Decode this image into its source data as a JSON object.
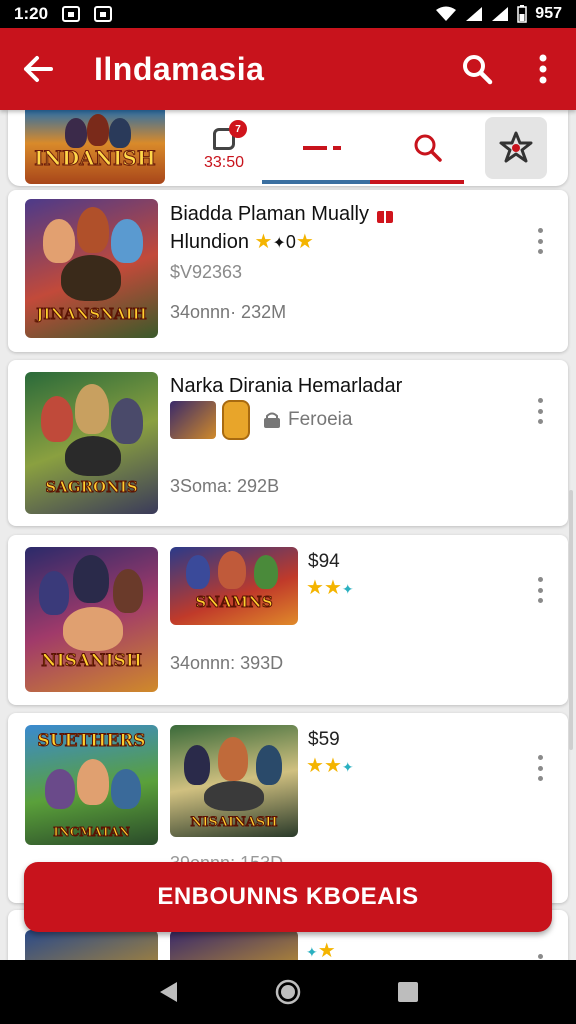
{
  "status": {
    "time": "1:20",
    "battery": "957"
  },
  "app_bar": {
    "title": "Ilndamasia",
    "back_icon": "arrow-left-icon",
    "search_icon": "search-icon",
    "menu_icon": "more-vert-icon"
  },
  "tabs": {
    "banner_logo": "INDANISH",
    "notif_badge": "7",
    "notif_count": "33:50"
  },
  "cards": [
    {
      "thumb_logo": "JINANSNAIH",
      "name_line1": "Biadda Plaman Mually",
      "name_line2": "Hlundion",
      "name_extra": "0",
      "price": "$V92363",
      "meta": "34onnn· 232M"
    },
    {
      "thumb_logo": "SAGRONIS",
      "name_line1": "Narka Dirania Hemarladar",
      "tag": "Feroeia",
      "meta": "3Soma: 292B"
    },
    {
      "thumb_logo": "NISANISH",
      "thumb2_logo": "SNAMNS",
      "price": "$94",
      "meta": "34onnn: 393D"
    },
    {
      "thumb_logo": "SUETHERS",
      "thumb_logo_sub": "INCMATAN",
      "thumb2_logo": "NISAINASH",
      "price": "$59",
      "meta": "39onnn: 153D"
    }
  ],
  "action_button": {
    "label": "ENBOUNNS KBOEAIS"
  },
  "colors": {
    "primary": "#c8131c",
    "star": "#f4b400"
  }
}
